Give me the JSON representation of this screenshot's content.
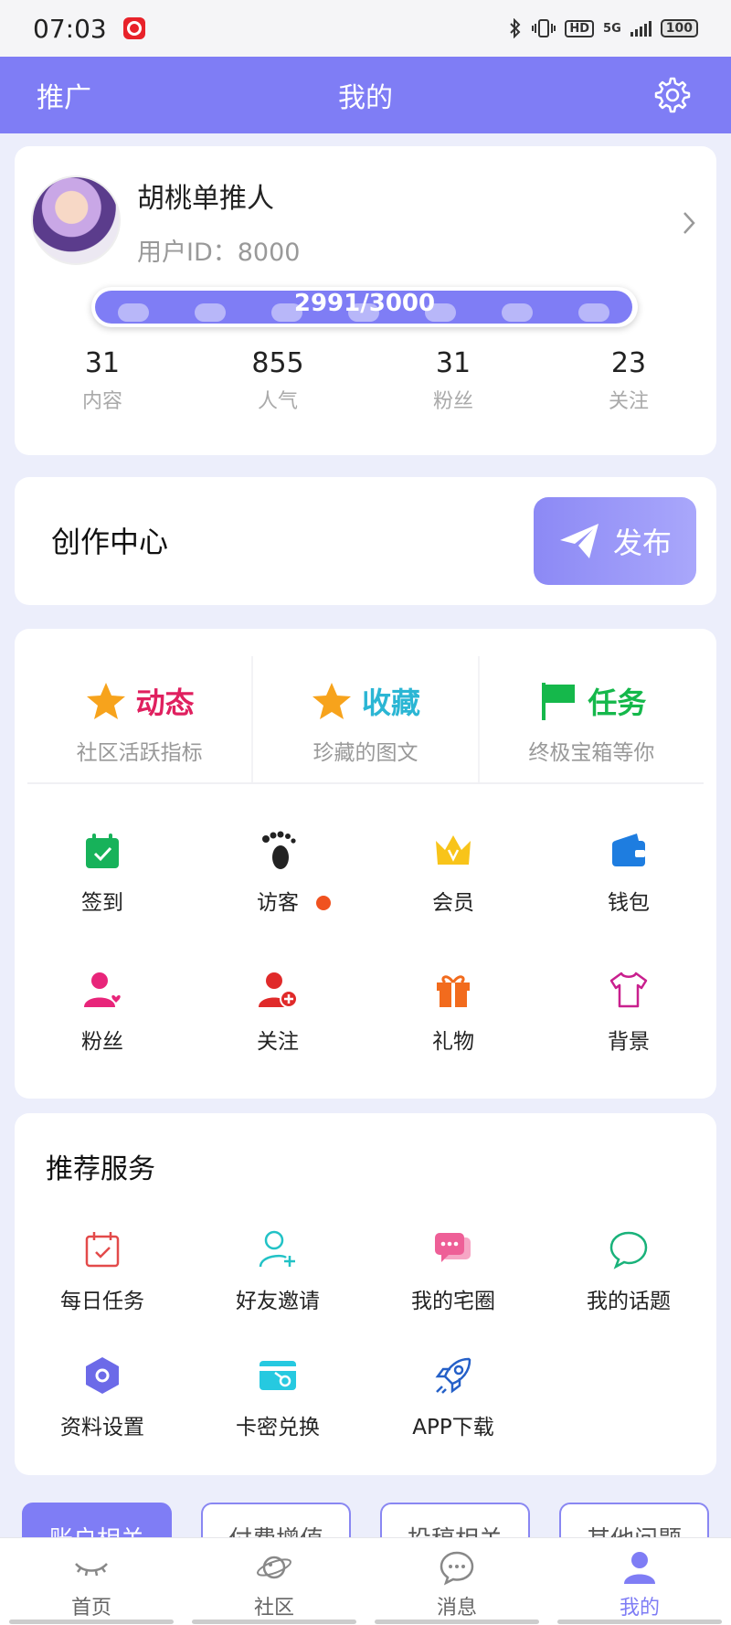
{
  "status_bar": {
    "time": "07:03",
    "hd": "HD",
    "network": "5G",
    "battery": "100"
  },
  "header": {
    "left_label": "推广",
    "title": "我的"
  },
  "profile": {
    "username": "胡桃单推人",
    "user_id": "用户ID：8000",
    "xp_text": "2991/3000",
    "xp_fraction": 0.997,
    "stats": [
      {
        "value": "31",
        "label": "内容"
      },
      {
        "value": "855",
        "label": "人气"
      },
      {
        "value": "31",
        "label": "粉丝"
      },
      {
        "value": "23",
        "label": "关注"
      }
    ]
  },
  "creation": {
    "title": "创作中心",
    "publish_label": "发布"
  },
  "quick": {
    "cards": [
      {
        "title": "动态",
        "subtitle": "社区活跃指标",
        "color": "#e0205f"
      },
      {
        "title": "收藏",
        "subtitle": "珍藏的图文",
        "color": "#2bb6d4"
      },
      {
        "title": "任务",
        "subtitle": "终极宝箱等你",
        "color": "#15b84b"
      }
    ],
    "items": [
      {
        "label": "签到",
        "icon": "calendar-check-icon"
      },
      {
        "label": "访客",
        "icon": "footprint-icon",
        "badge": true
      },
      {
        "label": "会员",
        "icon": "crown-icon"
      },
      {
        "label": "钱包",
        "icon": "wallet-icon"
      },
      {
        "label": "粉丝",
        "icon": "fans-icon"
      },
      {
        "label": "关注",
        "icon": "add-user-icon"
      },
      {
        "label": "礼物",
        "icon": "gift-icon"
      },
      {
        "label": "背景",
        "icon": "shirt-icon"
      }
    ]
  },
  "recommend": {
    "title": "推荐服务",
    "items": [
      {
        "label": "每日任务",
        "icon": "calendar-task-icon"
      },
      {
        "label": "好友邀请",
        "icon": "invite-friend-icon"
      },
      {
        "label": "我的宅圈",
        "icon": "chat-bubbles-icon"
      },
      {
        "label": "我的话题",
        "icon": "chat-icon"
      },
      {
        "label": "资料设置",
        "icon": "hexagon-settings-icon"
      },
      {
        "label": "卡密兑换",
        "icon": "card-icon"
      },
      {
        "label": "APP下载",
        "icon": "rocket-icon"
      }
    ]
  },
  "chips": [
    "账户相关",
    "付费增值",
    "投稿相关",
    "其他问题"
  ],
  "tabbar": [
    {
      "label": "首页",
      "icon": "eye-closed-icon"
    },
    {
      "label": "社区",
      "icon": "planet-icon"
    },
    {
      "label": "消息",
      "icon": "message-icon"
    },
    {
      "label": "我的",
      "icon": "user-icon",
      "active": true
    }
  ],
  "colors": {
    "accent": "#7f7df5",
    "background": "#eceefb"
  }
}
